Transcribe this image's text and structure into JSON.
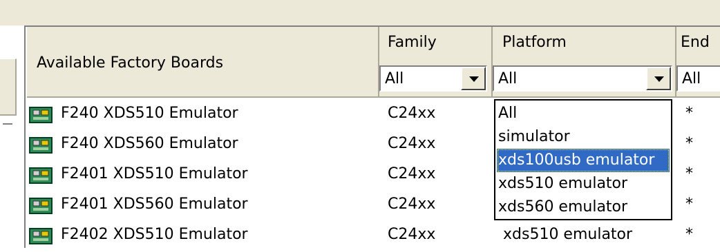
{
  "table": {
    "header_board": "Available Factory Boards",
    "header_family": "Family",
    "header_platform": "Platform",
    "header_endian": "End",
    "filter_family": "All",
    "filter_platform": "All",
    "filter_endian": "All",
    "rows": [
      {
        "board": "F240 XDS510 Emulator",
        "family": "C24xx",
        "platform": "",
        "endian": "*"
      },
      {
        "board": "F240 XDS560 Emulator",
        "family": "C24xx",
        "platform": "",
        "endian": "*"
      },
      {
        "board": "F2401 XDS510 Emulator",
        "family": "C24xx",
        "platform": "",
        "endian": "*"
      },
      {
        "board": "F2401 XDS560 Emulator",
        "family": "C24xx",
        "platform": "",
        "endian": "*"
      },
      {
        "board": "F2402 XDS510 Emulator",
        "family": "C24xx",
        "platform": "xds510 emulator",
        "endian": "*"
      }
    ]
  },
  "platform_dropdown": {
    "options": [
      "All",
      "simulator",
      "xds100usb emulator",
      "xds510 emulator",
      "xds560 emulator"
    ],
    "selected_index": 2
  },
  "colors": {
    "chrome": "#ece9d8",
    "selection": "#316ac5",
    "icon_green": "#2e8b57",
    "icon_yellow": "#e8c800"
  },
  "icons": {
    "board": "board-chip-icon",
    "dropdown": "chevron-down-icon"
  }
}
